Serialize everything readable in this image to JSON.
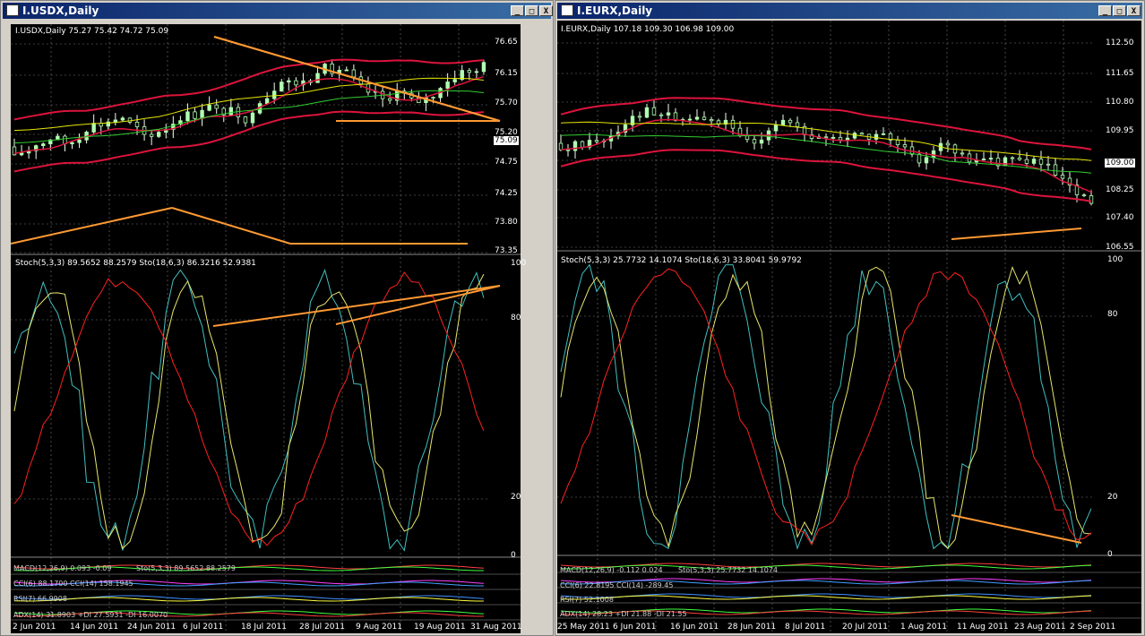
{
  "left": {
    "title": "I.USDX,Daily",
    "price_header": "I.USDX,Daily  75.27 75.42 74.72 75.09",
    "stoch_header": "Stoch(5,3,3) 89.5652 88.2579   Sto(18,6,3) 86.3216 52.9381",
    "price_axis": [
      "76.65",
      "76.15",
      "75.70",
      "75.20",
      "74.75",
      "74.25",
      "73.80",
      "73.35"
    ],
    "last_price": "75.09",
    "stoch_axis": [
      "100",
      "80",
      "20",
      "0"
    ],
    "macd": "MACD(12,26,9) 0.093 -0.09",
    "macd_sto": "Sto(5,3,3) 89.5652 88.2579",
    "cci": "CCI(6) 88.1700  CCI(14) 158.1945",
    "rsi": "RSI(7) 66.9908",
    "adx": "ADX(14) 31.8903 +DI 27.5931 -DI 16.0070",
    "dates": [
      "2 Jun 2011",
      "14 Jun 2011",
      "24 Jun 2011",
      "6 Jul 2011",
      "18 Jul 2011",
      "28 Jul 2011",
      "9 Aug 2011",
      "19 Aug 2011",
      "31 Aug 2011"
    ]
  },
  "right": {
    "title": "I.EURX,Daily",
    "price_header": "I.EURX,Daily  107.18 109.30 106.98 109.00",
    "stoch_header": "Stoch(5,3,3) 25.7732 14.1074   Sto(18,6,3) 33.8041 59.9792",
    "price_axis": [
      "112.50",
      "111.65",
      "110.80",
      "109.95",
      "108.25",
      "107.40",
      "106.55"
    ],
    "last_price": "109.00",
    "stoch_axis": [
      "100",
      "80",
      "20",
      "0"
    ],
    "macd": "MACD(12,26,9) -0.112 0.024",
    "macd_sto": "Sto(5,3,3) 25.7732 14.1074",
    "cci": "CCI(6) 22.8195  CCI(14) -289.45",
    "rsi": "RSI(7) 52.1008",
    "adx": "ADX(14) 28.23 +DI 21.88 -DI 21.55",
    "dates": [
      "25 May 2011",
      "6 Jun 2011",
      "16 Jun 2011",
      "28 Jun 2011",
      "8 Jul 2011",
      "20 Jul 2011",
      "1 Aug 2011",
      "11 Aug 2011",
      "23 Aug 2011",
      "2 Sep 2011"
    ]
  },
  "window_buttons": {
    "minimize": "_",
    "maximize": "□",
    "close": "X"
  },
  "colors": {
    "bg": "#000000",
    "bollinger": "#dc143c",
    "candle": "#f0fff0",
    "ma_yellow": "#e6e600",
    "ma_green": "#32cd32",
    "trend": "#ff9933",
    "stoch_main": "#e6e66e",
    "stoch_cyan": "#40c0c0",
    "stoch_red": "#ff2020"
  }
}
